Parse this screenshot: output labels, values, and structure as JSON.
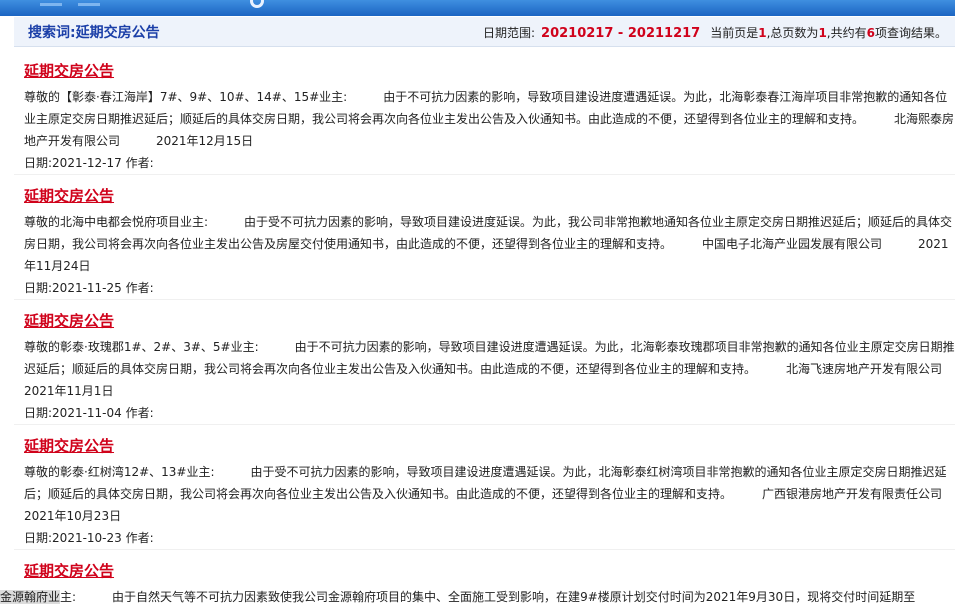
{
  "search": {
    "term": "搜索词:延期交房公告",
    "date_range_label": "日期范围:",
    "date_from": "20210217",
    "date_sep": " - ",
    "date_to": "20211217",
    "current_page_label": "当前页是",
    "current_page": "1",
    "total_pages_label": ",总页数为",
    "total_pages": "1",
    "results_label": ",共约有",
    "results_count": "6",
    "results_suffix": "项查询结果。"
  },
  "results": [
    {
      "title": "延期交房公告",
      "summary": "尊敬的【彰泰·春江海岸】7#、9#、10#、14#、15#业主:　　　由于不可抗力因素的影响，导致项目建设进度遭遇延误。为此，北海彰泰春江海岸项目非常抱歉的通知各位业主原定交房日期推迟延后；顺延后的具体交房日期，我公司将会再次向各位业主发出公告及入伙通知书。由此造成的不便，还望得到各位业主的理解和支持。　　　北海熙泰房地产开发有限公司　　　2021年12月15日",
      "date_label": "日期:",
      "date": "2021-12-17",
      "author_label": "作者:"
    },
    {
      "title": "延期交房公告",
      "summary": "尊敬的北海中电都会悦府项目业主:　　　由于受不可抗力因素的影响，导致项目建设进度延误。为此，我公司非常抱歉地通知各位业主原定交房日期推迟延后；顺延后的具体交房日期，我公司将会再次向各位业主发出公告及房屋交付使用通知书，由此造成的不便，还望得到各位业主的理解和支持。　　　中国电子北海产业园发展有限公司　　　2021年11月24日",
      "date_label": "日期:",
      "date": "2021-11-25",
      "author_label": "作者:"
    },
    {
      "title": "延期交房公告",
      "summary": "尊敬的彰泰·玫瑰郡1#、2#、3#、5#业主:　　　由于不可抗力因素的影响，导致项目建设进度遭遇延误。为此，北海彰泰玫瑰郡项目非常抱歉的通知各位业主原定交房日期推迟延后；顺延后的具体交房日期，我公司将会再次向各位业主发出公告及入伙通知书。由此造成的不便，还望得到各位业主的理解和支持。　　　北海飞速房地产开发有限公司　　　2021年11月1日",
      "date_label": "日期:",
      "date": "2021-11-04",
      "author_label": "作者:"
    },
    {
      "title": "延期交房公告",
      "summary": "尊敬的彰泰·红树湾12#、13#业主:　　　由于受不可抗力因素的影响，导致项目建设进度遭遇延误。为此，北海彰泰红树湾项目非常抱歉的通知各位业主原定交房日期推迟延后；顺延后的具体交房日期，我公司将会再次向各位业主发出公告及入伙通知书。由此造成的不便，还望得到各位业主的理解和支持。　　　广西银港房地产开发有限责任公司　　　2021年10月23日",
      "date_label": "日期:",
      "date": "2021-10-23",
      "author_label": "作者:"
    },
    {
      "title": "延期交房公告",
      "summary_highlight": "金源翰府业",
      "summary": "主:　　　由于自然天气等不可抗力因素致使我公司金源翰府项目的集中、全面施工受到影响，在建9#楼原计划交付时间为2021年9月30日，现将交付时间延期至"
    }
  ]
}
